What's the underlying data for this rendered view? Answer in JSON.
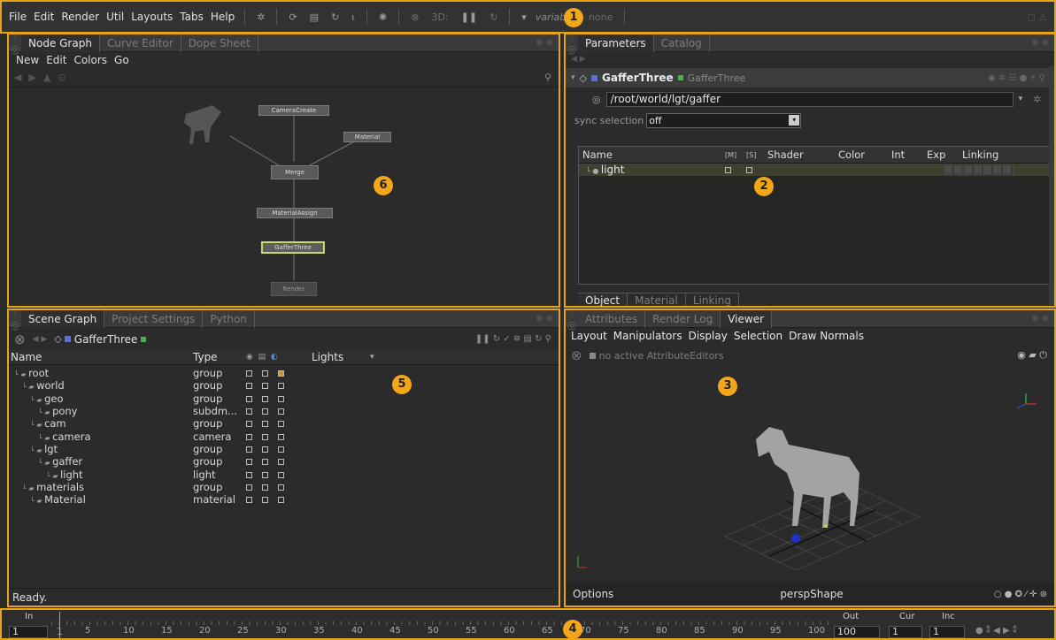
{
  "menubar": {
    "items": [
      "File",
      "Edit",
      "Render",
      "Util",
      "Layouts",
      "Tabs",
      "Help"
    ],
    "label_3d": "3D:",
    "variables_label": "variables",
    "variables_value": "none"
  },
  "badges": [
    "1",
    "2",
    "3",
    "4",
    "5",
    "6"
  ],
  "node_graph": {
    "tabs": [
      "Node Graph",
      "Curve Editor",
      "Dope Sheet"
    ],
    "menu": [
      "New",
      "Edit",
      "Colors",
      "Go"
    ],
    "nodes": {
      "camera_create": "CameraCreate",
      "material": "Material",
      "merge": "Merge",
      "material_assign": "MaterialAssign",
      "gaffer_three": "GafferThree",
      "render": "Render"
    }
  },
  "parameters": {
    "tabs": [
      "Parameters",
      "Catalog"
    ],
    "node_name": "GafferThree",
    "node_type": "GafferThree",
    "path": "/root/world/lgt/gaffer",
    "sync_label": "sync selection",
    "sync_value": "off",
    "columns": [
      "Name",
      "M",
      "S",
      "Shader",
      "Color",
      "Int",
      "Exp",
      "Linking"
    ],
    "rows": [
      {
        "name": "light"
      }
    ],
    "bottom_tabs": [
      "Object",
      "Material",
      "Linking"
    ]
  },
  "viewer": {
    "tabs": [
      "Attributes",
      "Render Log",
      "Viewer"
    ],
    "menu": [
      "Layout",
      "Manipulators",
      "Display",
      "Selection",
      "Draw Normals"
    ],
    "editor_status": "no active AttributeEditors",
    "options_label": "Options",
    "camera": "perspShape"
  },
  "scene_graph": {
    "tabs": [
      "Scene Graph",
      "Project Settings",
      "Python"
    ],
    "location": "GafferThree",
    "columns": [
      "Name",
      "Type",
      "Lights"
    ],
    "rows": [
      {
        "name": "root",
        "type": "group",
        "indent": 0
      },
      {
        "name": "world",
        "type": "group",
        "indent": 1
      },
      {
        "name": "geo",
        "type": "group",
        "indent": 2
      },
      {
        "name": "pony",
        "type": "subdm...",
        "indent": 3
      },
      {
        "name": "cam",
        "type": "group",
        "indent": 2
      },
      {
        "name": "camera",
        "type": "camera",
        "indent": 3
      },
      {
        "name": "lgt",
        "type": "group",
        "indent": 2
      },
      {
        "name": "gaffer",
        "type": "group",
        "indent": 3
      },
      {
        "name": "light",
        "type": "light",
        "indent": 4
      },
      {
        "name": "materials",
        "type": "group",
        "indent": 1
      },
      {
        "name": "Material",
        "type": "material",
        "indent": 2
      }
    ],
    "status": "Ready."
  },
  "timeline": {
    "in_label": "In",
    "in_value": "1",
    "out_label": "Out",
    "out_value": "100",
    "cur_label": "Cur",
    "cur_value": "1",
    "inc_label": "Inc",
    "inc_value": "1",
    "current_frame": "1",
    "ticks": [
      "5",
      "10",
      "15",
      "20",
      "25",
      "30",
      "35",
      "40",
      "45",
      "50",
      "55",
      "60",
      "65",
      "70",
      "75",
      "80",
      "85",
      "90",
      "95",
      "100"
    ]
  },
  "colors": {
    "highlight": "#e8a317",
    "gaffer_selected": "#c8d86a"
  }
}
